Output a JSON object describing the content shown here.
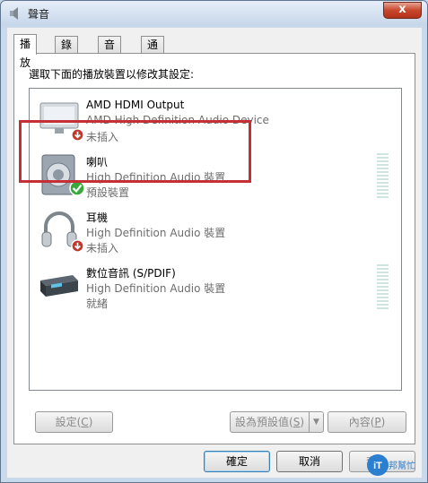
{
  "window": {
    "title": "聲音",
    "close_glyph": "x"
  },
  "tabs": [
    {
      "label": "播放",
      "active": true
    },
    {
      "label": "錄製",
      "active": false
    },
    {
      "label": "音效",
      "active": false
    },
    {
      "label": "通訊",
      "active": false
    }
  ],
  "instruction": "選取下面的播放裝置以修改其設定:",
  "devices": [
    {
      "name": "AMD HDMI Output",
      "description": "AMD High Definition Audio Device",
      "state": "未插入",
      "icon": "monitor-icon",
      "badge": "unplugged-badge-icon"
    },
    {
      "name": "喇叭",
      "description": "High Definition Audio 裝置",
      "state": "預設裝置",
      "icon": "speaker-icon",
      "badge": "default-check-icon"
    },
    {
      "name": "耳機",
      "description": "High Definition Audio 裝置",
      "state": "未插入",
      "icon": "headphones-icon",
      "badge": "unplugged-badge-icon"
    },
    {
      "name": "數位音訊 (S/PDIF)",
      "description": "High Definition Audio 裝置",
      "state": "就緒",
      "icon": "spdif-receiver-icon",
      "badge": ""
    }
  ],
  "buttons": {
    "configure": {
      "label": "設定(",
      "key": "C",
      "suffix": ")"
    },
    "set_default": {
      "label": "設為預設值(",
      "key": "S",
      "suffix": ")"
    },
    "properties": {
      "label": "內容(",
      "key": "P",
      "suffix": ")"
    },
    "ok": "確定",
    "cancel": "取消",
    "apply": "套"
  },
  "watermark": {
    "text": "iT邦幫忙"
  },
  "colors": {
    "highlight": "#c62f35",
    "check_green": "#3aa83a",
    "unplugged_red": "#c0392b",
    "meter": "#cfe4e1"
  }
}
